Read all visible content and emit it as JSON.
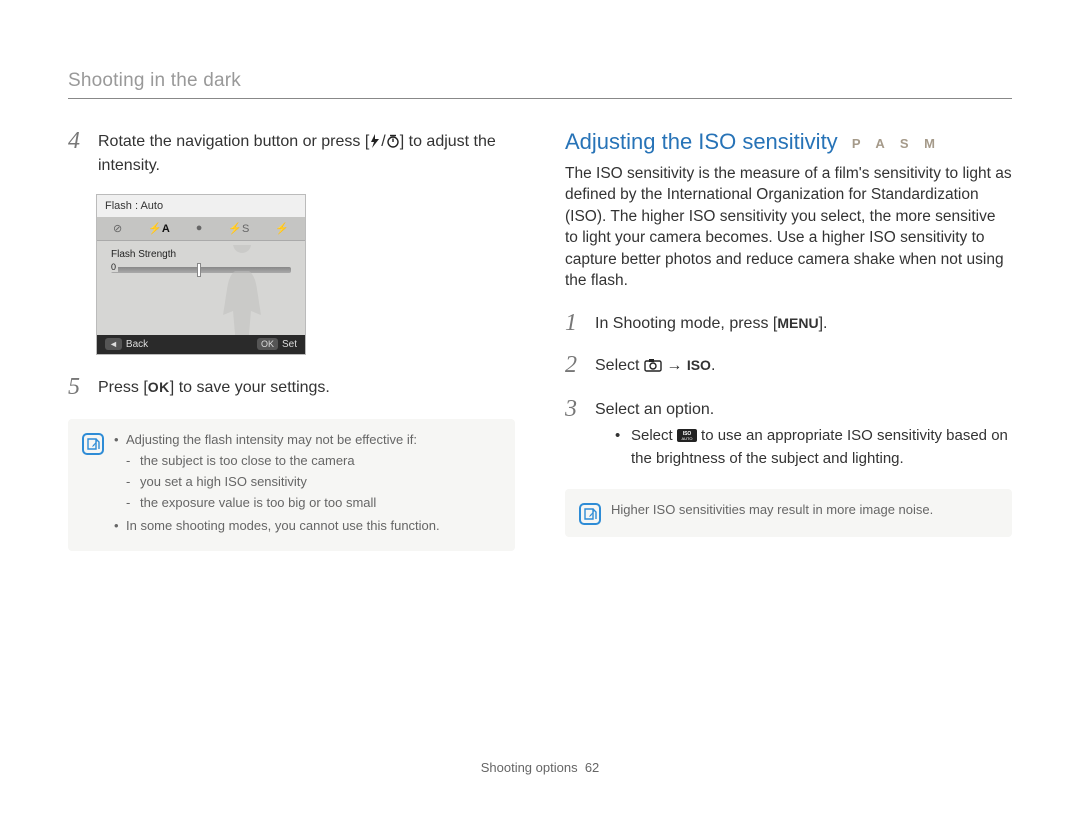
{
  "header": {
    "section_title": "Shooting in the dark"
  },
  "left": {
    "step4": {
      "num": "4",
      "text_a": "Rotate the navigation button or press [",
      "text_b": "/",
      "text_c": "] to adjust the intensity."
    },
    "lcd": {
      "top": "Flash : Auto",
      "strength_label": "Flash Strength",
      "back_btn": "Back",
      "set_btn": "Set",
      "ok_small": "OK",
      "icons": [
        "⊘",
        "⚡A",
        "●",
        "⚡S",
        "⚡"
      ]
    },
    "step5": {
      "num": "5",
      "text_a": "Press [",
      "ok": "OK",
      "text_b": "] to save your settings."
    },
    "note": {
      "lead": "Adjusting the flash intensity may not be effective if:",
      "sub": [
        "the subject is too close to the camera",
        "you set a high ISO sensitivity",
        "the exposure value is too big or too small"
      ],
      "extra": "In some shooting modes, you cannot use this function."
    }
  },
  "right": {
    "heading": "Adjusting the ISO sensitivity",
    "modes": "P A S M",
    "para": "The ISO sensitivity is the measure of a film's sensitivity to light as defined by the International Organization for Standardization (ISO). The higher ISO sensitivity you select, the more sensitive to light your camera becomes. Use a higher ISO sensitivity to capture better photos and reduce camera shake when not using the flash.",
    "step1": {
      "num": "1",
      "text_a": "In Shooting mode, press [",
      "menu": "MENU",
      "text_b": "]."
    },
    "step2": {
      "num": "2",
      "text_a": "Select ",
      "arrow": " → ",
      "iso": "ISO",
      "text_b": "."
    },
    "step3": {
      "num": "3",
      "text": "Select an option.",
      "bullet_a": "Select ",
      "bullet_b": " to use an appropriate ISO sensitivity based on the brightness of the subject and lighting."
    },
    "note": "Higher ISO sensitivities may result in more image noise."
  },
  "footer": {
    "chapter": "Shooting options",
    "page": "62"
  }
}
